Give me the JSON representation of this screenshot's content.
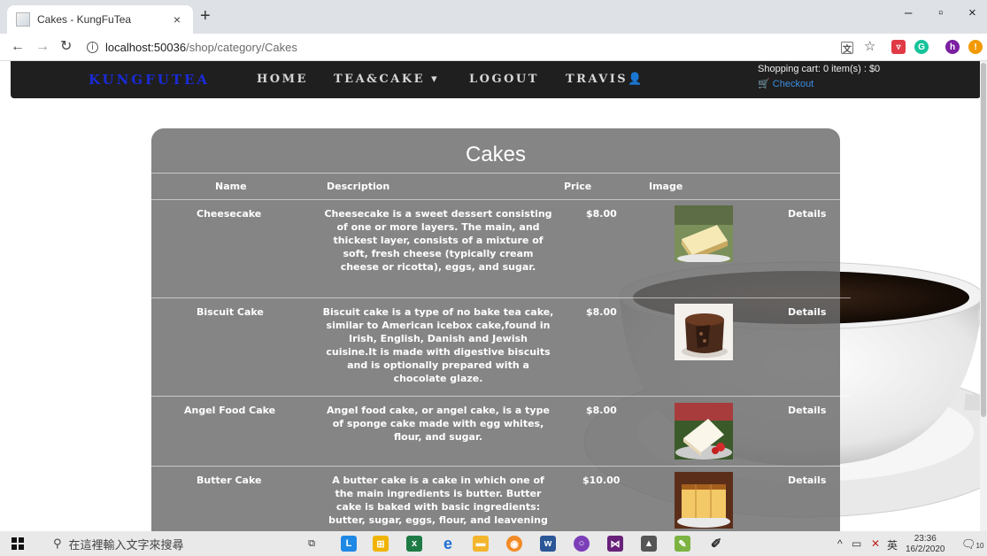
{
  "browser": {
    "tab_title": "Cakes - KungFuTea",
    "tab_close": "×",
    "new_tab": "+",
    "url_host": "localhost:50036",
    "url_path": "/shop/category/Cakes",
    "controls": {
      "minimize": "–",
      "restore": "▫",
      "close": "×"
    }
  },
  "site": {
    "brand": "KUNGFUTEA",
    "nav": [
      "HOME",
      "TEA&CAKE ▾",
      "LOGOUT",
      "TRAVIS"
    ],
    "cart_text": "Shopping cart: 0 item(s) : $0",
    "checkout": "Checkout"
  },
  "table": {
    "title": "Cakes",
    "headers": {
      "name": "Name",
      "description": "Description",
      "price": "Price",
      "image": "Image"
    },
    "rows": [
      {
        "name": "Cheesecake",
        "description": "Cheesecake is a sweet dessert consisting of one or more layers. The main, and thickest layer, consists of a mixture of soft, fresh cheese (typically cream cheese or ricotta), eggs, and sugar.",
        "price": "$8.00",
        "action": "Details"
      },
      {
        "name": "Biscuit Cake",
        "description": "Biscuit cake is a type of no bake tea cake, similar to American icebox cake,found in Irish, English, Danish and Jewish cuisine.It is made with digestive biscuits and is optionally prepared with a chocolate glaze.",
        "price": "$8.00",
        "action": "Details"
      },
      {
        "name": "Angel Food Cake",
        "description": "Angel food cake, or angel cake, is a type of sponge cake made with egg whites, flour, and sugar.",
        "price": "$8.00",
        "action": "Details"
      },
      {
        "name": "Butter Cake",
        "description": "A butter cake is a cake in which one of the main ingredients is butter. Butter cake is baked with basic ingredients: butter, sugar, eggs, flour, and leavening",
        "price": "$10.00",
        "action": "Details"
      }
    ]
  },
  "taskbar": {
    "search_placeholder": "在這裡輸入文字來搜尋",
    "ime": "英",
    "time": "23:36",
    "date": "16/2/2020",
    "notification_count": "10"
  },
  "colors": {
    "brand": "#1a2bd6",
    "navbar": "#1f1f1f",
    "panel": "#6e6e6e",
    "link": "#3b8de0"
  }
}
